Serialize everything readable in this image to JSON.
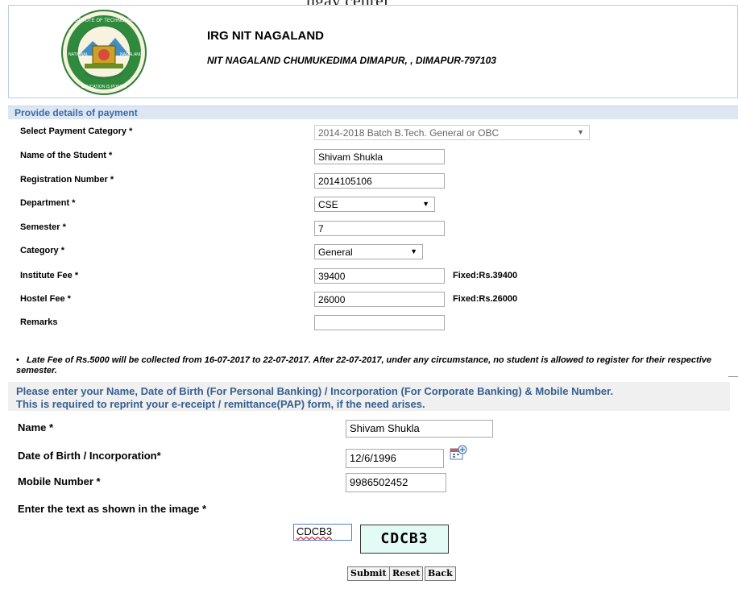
{
  "org": {
    "name": "IRG NIT NAGALAND",
    "address": "NIT NAGALAND CHUMUKEDIMA DIMAPUR, , DIMAPUR-797103",
    "logo_text_top": "INSTITUTE OF TECHNOLOGY",
    "logo_text_left": "NATIONAL",
    "logo_text_right": "NAGALAND",
    "logo_motto": "EDUCATION IS POWER"
  },
  "payment": {
    "section_title": "Provide details of payment",
    "fields": [
      {
        "label": "Select Payment Category *",
        "value": "2014-2018 Batch B.Tech. General or OBC"
      },
      {
        "label": "Name of the Student *",
        "value": "Shivam Shukla"
      },
      {
        "label": "Registration Number *",
        "value": "2014105106"
      },
      {
        "label": "Department *",
        "value": "CSE"
      },
      {
        "label": "Semester *",
        "value": "7"
      },
      {
        "label": "Category *",
        "value": "General"
      },
      {
        "label": "Institute Fee *",
        "value": "39400",
        "hint": "Fixed:Rs.39400"
      },
      {
        "label": "Hostel Fee *",
        "value": "26000",
        "hint": "Fixed:Rs.26000"
      },
      {
        "label": "Remarks",
        "value": ""
      }
    ]
  },
  "note": {
    "bullet": "•",
    "text": "Late Fee of Rs.5000 will be collected from 16-07-2017 to 22-07-2017. After 22-07-2017, under any circumstance, no student is allowed to register for their respective semester."
  },
  "info": {
    "line1": "Please enter your Name, Date of Birth (For Personal Banking) / Incorporation (For Corporate Banking)  & Mobile Number.",
    "line2": "This is required to reprint your e-receipt / remittance(PAP) form, if the need arises."
  },
  "personal": {
    "name_label": "Name *",
    "name_value": "Shivam Shukla",
    "dob_label": "Date of Birth / Incorporation*",
    "dob_value": "12/6/1996",
    "mobile_label": "Mobile Number *",
    "mobile_value": "9986502452",
    "captcha_label": "Enter the text as shown in the image *",
    "captcha_input": "CDCB3",
    "captcha_image_text": "CDCB3"
  },
  "buttons": {
    "submit": "Submit",
    "reset": "Reset",
    "back": "Back"
  },
  "colors": {
    "section_bar": "#dde7f3",
    "section_text": "#3b6aa8",
    "info_text": "#365f91",
    "captcha_bg": "#e3fbf5"
  }
}
